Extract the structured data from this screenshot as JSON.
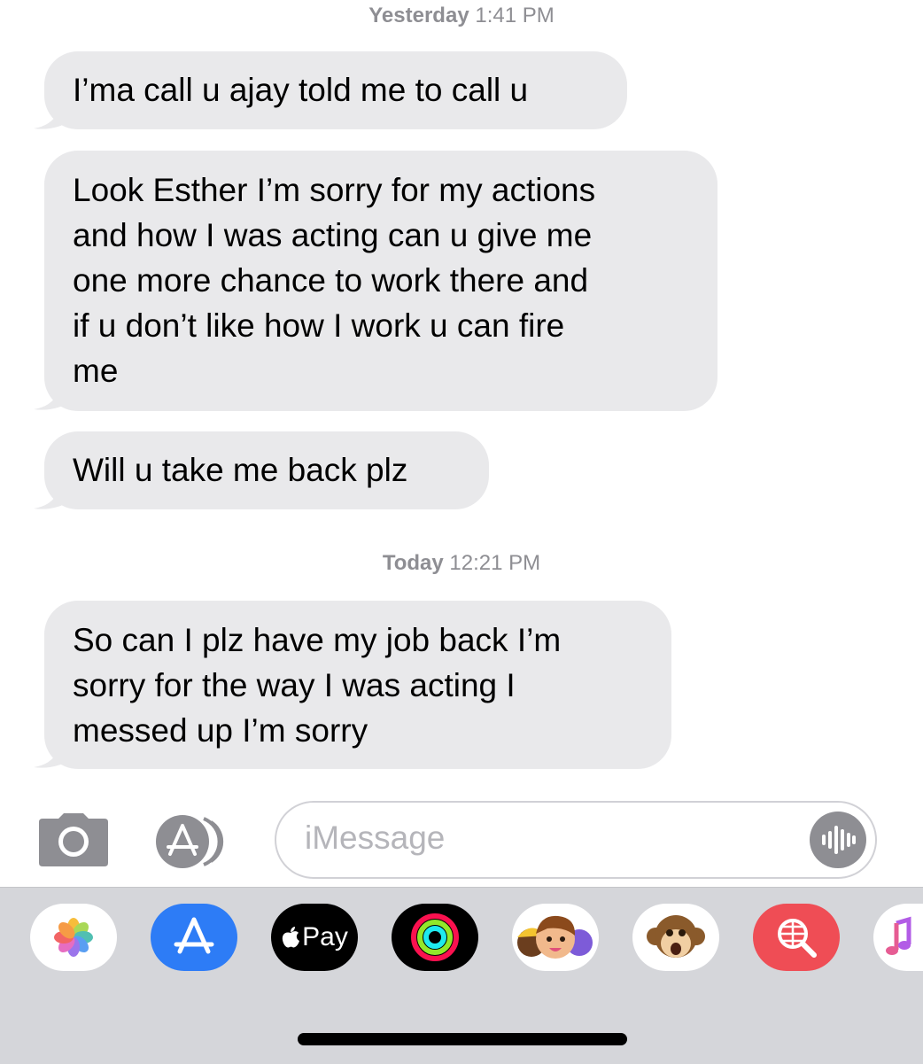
{
  "conversation": {
    "groups": [
      {
        "day": "Yesterday",
        "time": "1:41 PM",
        "messages": [
          {
            "lines": [
              "I’ma call u ajay told me to call u"
            ]
          },
          {
            "lines": [
              "Look Esther I’m sorry for my actions",
              "and how I was acting can u give me",
              "one more chance to work there and",
              "if u don’t like how I work u can fire",
              "me"
            ]
          },
          {
            "lines": [
              "Will u take me back plz"
            ]
          }
        ]
      },
      {
        "day": "Today",
        "time": "12:21 PM",
        "messages": [
          {
            "lines": [
              "So can I plz have my job back I’m",
              "sorry for the way I was acting I",
              "messed up I’m sorry"
            ]
          }
        ]
      }
    ]
  },
  "input_bar": {
    "placeholder": "iMessage",
    "camera_icon": "camera-icon",
    "apps_icon": "app-store-icon",
    "audio_icon": "audio-waveform-icon"
  },
  "app_drawer": {
    "apps": [
      {
        "name": "photos-icon"
      },
      {
        "name": "app-store-icon"
      },
      {
        "name": "apple-pay-icon",
        "label": "Pay"
      },
      {
        "name": "activity-icon"
      },
      {
        "name": "memoji-icon"
      },
      {
        "name": "animoji-monkey-icon"
      },
      {
        "name": "web-images-search-icon"
      },
      {
        "name": "music-icon"
      }
    ]
  },
  "colors": {
    "bubble": "#e9e9eb",
    "timestamp": "#8e8e93",
    "drawer": "#d5d6da",
    "app_store_blue": "#2d7cf6",
    "search_red": "#ef4d55"
  }
}
